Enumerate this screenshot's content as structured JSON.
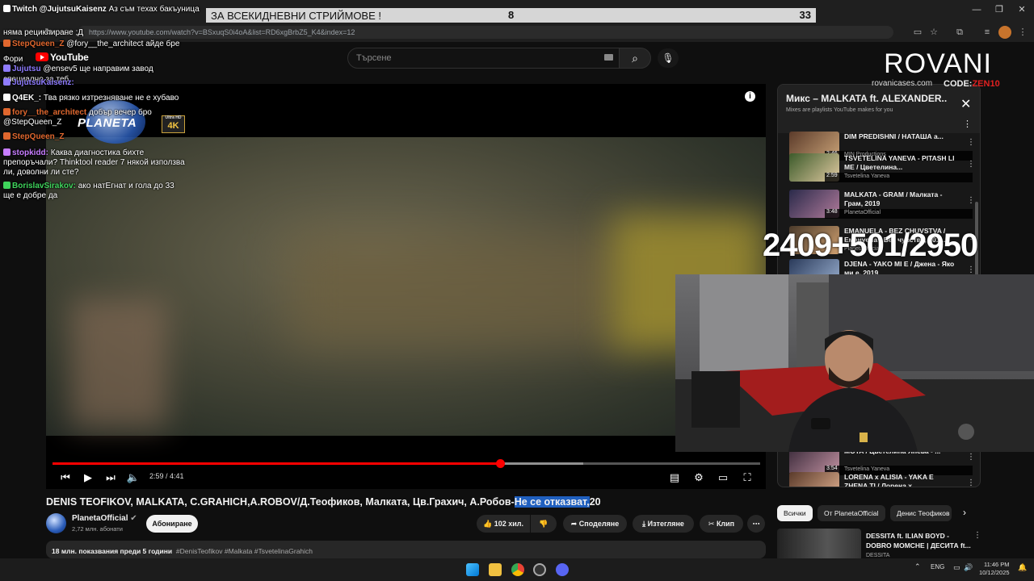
{
  "browser": {
    "url": "https://www.youtube.com/watch?v=BSxuqS0i4oA&list=RD6xgBrbZ5_K4&index=12"
  },
  "goal_bar": {
    "label": "ЗА ВСЕКИДНЕВНИ СТРИЙМОВЕ !",
    "current": "8",
    "target": "33"
  },
  "youtube": {
    "logo_text": "YouTube",
    "search_placeholder": "Търсене"
  },
  "chat": [
    {
      "user": "Twitch @JujutsuKaisenz",
      "msg": "Аз съм техах бакъуница",
      "color": "#ffffff"
    },
    {
      "user": "",
      "msg": "няма рециклиране ;Д",
      "color": "#ffffff"
    },
    {
      "user": "StepQueen_Z",
      "msg": "@fory__the_architect айде бре",
      "color": "#e0672e"
    },
    {
      "user": "",
      "msg": "Фори",
      "color": "#ffffff"
    },
    {
      "user": "Jujutsu",
      "msg": "@ensev5 ще направим завод",
      "color": "#8f7cff"
    },
    {
      "user": "",
      "msg": "специално за теб",
      "color": "#ffffff"
    },
    {
      "user": "JujutsuKaisenz:",
      "msg": "",
      "color": "#8f7cff"
    },
    {
      "user": "Q4EK_:",
      "msg": "Тва рязко изтрезняване не е хубаво",
      "color": "#ffffff"
    },
    {
      "user": "fory__the_architect",
      "msg": "добър вечер бро",
      "color": "#e0672e"
    },
    {
      "user": "",
      "msg": "@StepQueen_Z",
      "color": "#ffffff"
    },
    {
      "user": "StepQueen_Z",
      "msg": "",
      "color": "#e0672e"
    },
    {
      "user": "stopkidd:",
      "msg": "Каква диагностика бихте",
      "color": "#c77dff"
    },
    {
      "user": "",
      "msg": "препоръчали? Thinktool reader 7 някой използва",
      "color": "#ffffff"
    },
    {
      "user": "",
      "msg": "ли, доволни ли сте?",
      "color": "#ffffff"
    },
    {
      "user": "BorislavSirakov:",
      "msg": "ако натЕгнат и гола до 33",
      "color": "#3fd45c"
    },
    {
      "user": "",
      "msg": "ще е добре да",
      "color": "#ffffff"
    }
  ],
  "player": {
    "time": "2:59 / 4:41",
    "progress": 0.6323,
    "buffered": 0.75,
    "channel_logo": "PLANETA",
    "badge_4k": "4K",
    "badge_small": "Ultra HD"
  },
  "video": {
    "title_before": "DENIS TEOFIKOV, MALKATA, C.GRAHICH,A.ROBOV/Д.Теофиков, Малката, Цв.Грахич, А.Робов-",
    "title_highlight": "Не се отказват,",
    "title_after": "20",
    "channel": "PlanetaOfficial",
    "subs": "2,72 млн. абонати",
    "subscribe": "Абониране",
    "likes": "102 хил.",
    "share": "Споделяне",
    "download": "Изтегляне",
    "clip": "Клип",
    "views": "18 млн. показвания  преди 5 години",
    "tags": "#DenisTeofikov #Malkata #TsvetelinaGrahich"
  },
  "mix": {
    "title": "Микс – MALKATA ft. ALEXANDER...",
    "subtitle": "Mixes are playlists YouTube makes for you",
    "items": [
      {
        "title": "DIM PREDISHNI / НАТАША а...",
        "channel": "MIN Productions",
        "dur": "2:46",
        "c1": "#5b3b2a",
        "c2": "#c9a277"
      },
      {
        "title": "TSVETELINA YANEVA - PITASH LI ME / Цветелина...",
        "channel": "Tsvetelina Yaneva",
        "dur": "2:59",
        "c1": "#3b5a2a",
        "c2": "#e0c9a0"
      },
      {
        "title": "MALKATA - GRAM / Малката - Грам, 2019",
        "channel": "PlanetaOfficial",
        "dur": "3:48",
        "c1": "#2a2a4a",
        "c2": "#b07a9a"
      },
      {
        "title": "EMANUELA - BEZ CHUVSTVA / Емануела - Без чувства, 201...",
        "channel": "PlanetaOfficial",
        "dur": "",
        "c1": "#4a3a2a",
        "c2": "#d0a070"
      },
      {
        "title": "DJENA - YAKO MI E / Джена - Яко ми е, 2019",
        "channel": "",
        "dur": "",
        "c1": "#2a3a5a",
        "c2": "#9ab0d0"
      }
    ],
    "bottom_items": [
      {
        "title": "MOTA / Цветелина Янева - ...",
        "channel": "Tsvetelina Yaneva",
        "dur": "3:54",
        "c1": "#3a2a3a",
        "c2": "#c090a0"
      },
      {
        "title": "LORENA x ALISIA - YAKA E ZHENA TI / Лорена х...",
        "channel": "",
        "dur": "",
        "c1": "#5a3a2a",
        "c2": "#e0b090"
      }
    ]
  },
  "chips": [
    "Всички",
    "От PlanetaOfficial",
    "Денис Теофиков"
  ],
  "recommended": {
    "title": "DESSITA ft. ILIAN BOYD - DOBRO MOMCHE | ДЕСИТА ft...",
    "channel": "DESSITA"
  },
  "overlay": {
    "sponsor": "ROVANI",
    "sponsor_site": "rovanicases.com",
    "code_label": "CODE:",
    "code_value": "ZEN10",
    "counter": "2409+501/2950"
  },
  "taskbar": {
    "lang": "ENG",
    "time": "11:46 PM",
    "date": "10/12/2025"
  }
}
